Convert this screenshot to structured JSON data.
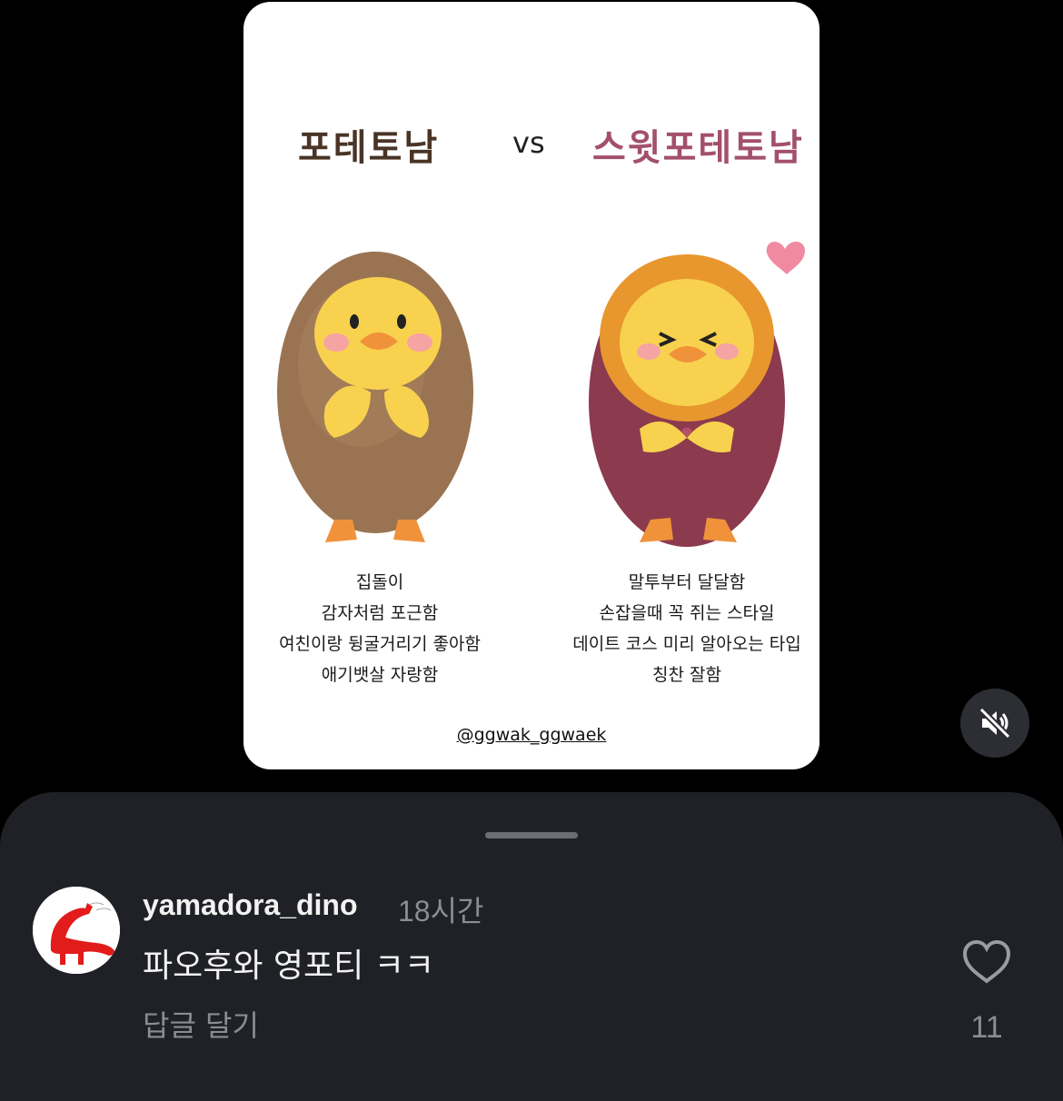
{
  "post": {
    "title_left": "포테토남",
    "title_vs": "vs",
    "title_right": "스윗포테토남",
    "desc_left": [
      "집돌이",
      "감자처럼 포근함",
      "여친이랑 뒹굴거리기 좋아함",
      "애기뱃살 자랑함"
    ],
    "desc_right": [
      "말투부터 달달함",
      "손잡을때 꼭 쥐는 스타일",
      "데이트 코스 미리 알아오는 타입",
      "칭찬 잘함"
    ],
    "handle": "@ggwak_ggwaek",
    "illustration_left": "potato-duck-illustration",
    "illustration_right": "sweet-potato-duck-illustration"
  },
  "video_controls": {
    "mute_icon": "speaker-muted-icon"
  },
  "comment": {
    "username": "yamadora_dino",
    "timestamp": "18시간",
    "text": "파오후와 영포티 ㅋㅋ",
    "reply_label": "답글 달기",
    "like_count": "11",
    "like_icon": "heart-outline-icon"
  },
  "colors": {
    "background": "#000000",
    "sheet": "#1f2126",
    "text_primary": "#f2f2f2",
    "text_secondary": "#8a8d93",
    "title_left": "#4a3426",
    "title_right": "#a3506a"
  }
}
